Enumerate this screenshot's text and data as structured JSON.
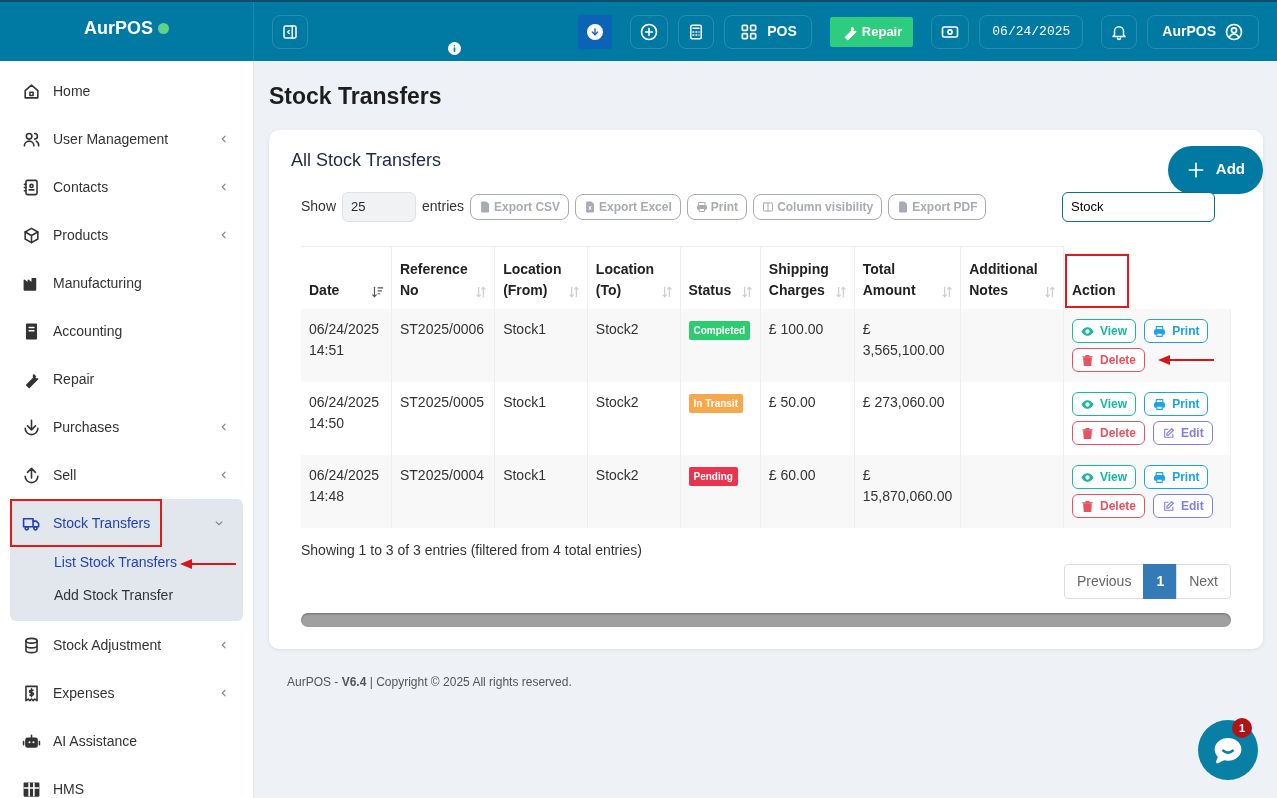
{
  "brand": {
    "name": "AurPOS",
    "online": true
  },
  "topbar": {
    "pos_label": "POS",
    "repair_label": "Repair",
    "date": "06/24/2025",
    "user": "AurPOS"
  },
  "sidebar": {
    "items": [
      {
        "label": "Home",
        "has_submenu": false,
        "expanded": false,
        "selected": false,
        "highlighted": false
      },
      {
        "label": "User Management",
        "has_submenu": true,
        "expanded": false,
        "selected": false,
        "highlighted": false
      },
      {
        "label": "Contacts",
        "has_submenu": true,
        "expanded": false,
        "selected": false,
        "highlighted": false
      },
      {
        "label": "Products",
        "has_submenu": true,
        "expanded": false,
        "selected": false,
        "highlighted": false
      },
      {
        "label": "Manufacturing",
        "has_submenu": false,
        "expanded": false,
        "selected": false,
        "highlighted": false
      },
      {
        "label": "Accounting",
        "has_submenu": false,
        "expanded": false,
        "selected": false,
        "highlighted": false
      },
      {
        "label": "Repair",
        "has_submenu": false,
        "expanded": false,
        "selected": false,
        "highlighted": false
      },
      {
        "label": "Purchases",
        "has_submenu": true,
        "expanded": false,
        "selected": false,
        "highlighted": false
      },
      {
        "label": "Sell",
        "has_submenu": true,
        "expanded": false,
        "selected": false,
        "highlighted": false
      },
      {
        "label": "Stock Transfers",
        "has_submenu": true,
        "expanded": true,
        "selected": true,
        "highlighted": true,
        "children": [
          {
            "label": "List Stock Transfers",
            "selected": true,
            "pointed": true
          },
          {
            "label": "Add Stock Transfer",
            "selected": false,
            "pointed": false
          }
        ]
      },
      {
        "label": "Stock Adjustment",
        "has_submenu": true,
        "expanded": false,
        "selected": false,
        "highlighted": false
      },
      {
        "label": "Expenses",
        "has_submenu": true,
        "expanded": false,
        "selected": false,
        "highlighted": false
      },
      {
        "label": "AI Assistance",
        "has_submenu": false,
        "expanded": false,
        "selected": false,
        "highlighted": false
      },
      {
        "label": "HMS",
        "has_submenu": false,
        "expanded": false,
        "selected": false,
        "highlighted": false
      }
    ]
  },
  "page_title": "Stock Transfers",
  "card": {
    "title": "All Stock Transfers",
    "add_label": "Add",
    "show_label": "Show",
    "page_size": "25",
    "entries_label": "entries",
    "export_buttons": [
      "Export CSV",
      "Export Excel",
      "Print",
      "Column visibility",
      "Export PDF"
    ],
    "search_value": "Stock",
    "table": {
      "columns": [
        {
          "label": "Date",
          "sortable": true,
          "sorted": true,
          "highlighted": false
        },
        {
          "label": "Reference No",
          "sortable": true,
          "sorted": false,
          "highlighted": false
        },
        {
          "label": "Location (From)",
          "sortable": true,
          "sorted": false,
          "highlighted": false
        },
        {
          "label": "Location (To)",
          "sortable": true,
          "sorted": false,
          "highlighted": false
        },
        {
          "label": "Status",
          "sortable": true,
          "sorted": false,
          "highlighted": false
        },
        {
          "label": "Shipping Charges",
          "sortable": true,
          "sorted": false,
          "highlighted": false
        },
        {
          "label": "Total Amount",
          "sortable": true,
          "sorted": false,
          "highlighted": false
        },
        {
          "label": "Additional Notes",
          "sortable": true,
          "sorted": false,
          "highlighted": false
        },
        {
          "label": "Action",
          "sortable": false,
          "highlighted": true
        }
      ],
      "rows": [
        {
          "date": "06/24/2025 14:51",
          "reference": "ST2025/0006",
          "from": "Stock1",
          "to": "Stock2",
          "status": "Completed",
          "color": "#2ecc71",
          "shipping": "£ 100.00",
          "total": "£ 3,565,100.00",
          "delete_pointed": true,
          "actions": [
            {
              "kind": "view",
              "label": "View"
            },
            {
              "kind": "print",
              "label": "Print"
            },
            {
              "kind": "delete",
              "label": "Delete"
            }
          ]
        },
        {
          "date": "06/24/2025 14:50",
          "reference": "ST2025/0005",
          "from": "Stock1",
          "to": "Stock2",
          "status": "In Transit",
          "color": "#f7a84a",
          "shipping": "£ 50.00",
          "total": "£ 273,060.00",
          "delete_pointed": false,
          "actions": [
            {
              "kind": "view",
              "label": "View"
            },
            {
              "kind": "print",
              "label": "Print"
            },
            {
              "kind": "delete",
              "label": "Delete"
            },
            {
              "kind": "edit",
              "label": "Edit"
            }
          ]
        },
        {
          "date": "06/24/2025 14:48",
          "reference": "ST2025/0004",
          "from": "Stock1",
          "to": "Stock2",
          "status": "Pending",
          "color": "#e8344e",
          "shipping": "£ 60.00",
          "total": "£ 15,870,060.00",
          "delete_pointed": false,
          "actions": [
            {
              "kind": "view",
              "label": "View"
            },
            {
              "kind": "print",
              "label": "Print"
            },
            {
              "kind": "delete",
              "label": "Delete"
            },
            {
              "kind": "edit",
              "label": "Edit"
            }
          ]
        }
      ]
    },
    "info": "Showing 1 to 3 of 3 entries (filtered from 4 total entries)",
    "pagination": [
      {
        "label": "Previous",
        "selected": false
      },
      {
        "label": "1",
        "selected": true
      },
      {
        "label": "Next",
        "selected": false
      }
    ]
  },
  "footer": "AurPOS - **V6.4** | Copyright © 2025 All rights reserved.",
  "chat": {
    "unread": "1"
  }
}
